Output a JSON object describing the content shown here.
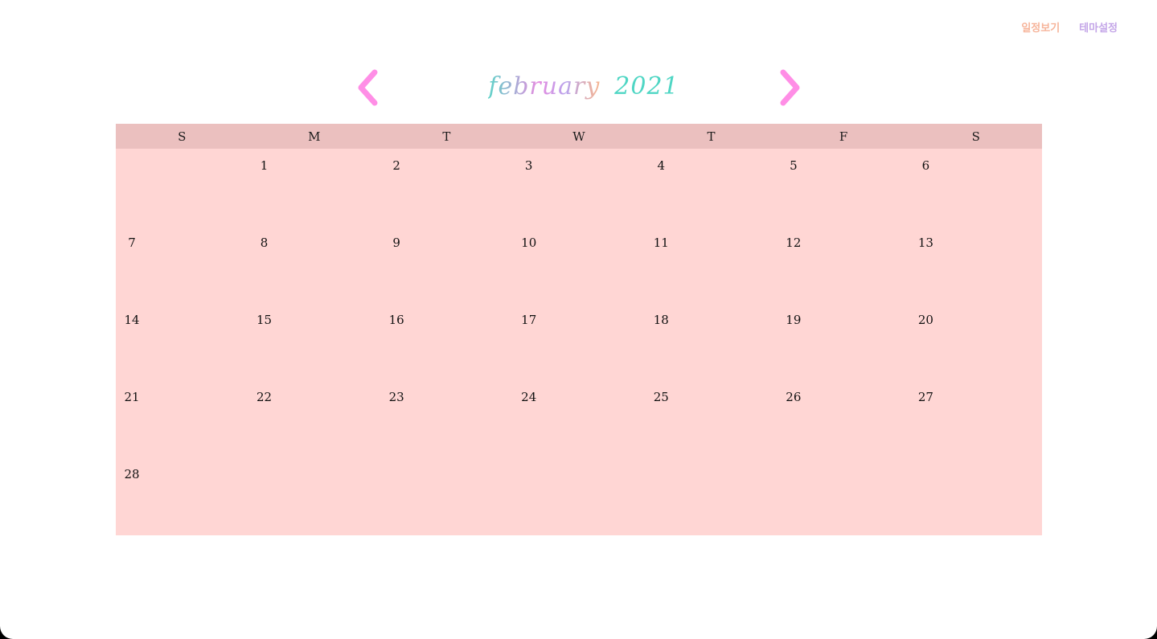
{
  "nav": {
    "schedule_label": "일정보기",
    "theme_label": "테마설정"
  },
  "header": {
    "month": "february",
    "year": "2021",
    "prev_icon": "chevron-left-icon",
    "next_icon": "chevron-right-icon",
    "arrow_color": "#ff8ee6"
  },
  "calendar": {
    "weekdays": [
      "S",
      "M",
      "T",
      "W",
      "T",
      "F",
      "S"
    ],
    "weeks": [
      [
        "",
        "1",
        "2",
        "3",
        "4",
        "5",
        "6"
      ],
      [
        "7",
        "8",
        "9",
        "10",
        "11",
        "12",
        "13"
      ],
      [
        "14",
        "15",
        "16",
        "17",
        "18",
        "19",
        "20"
      ],
      [
        "21",
        "22",
        "23",
        "24",
        "25",
        "26",
        "27"
      ],
      [
        "28",
        "",
        "",
        "",
        "",
        "",
        ""
      ]
    ],
    "header_bg": "#ebc0bf",
    "body_bg": "#ffd6d4"
  }
}
